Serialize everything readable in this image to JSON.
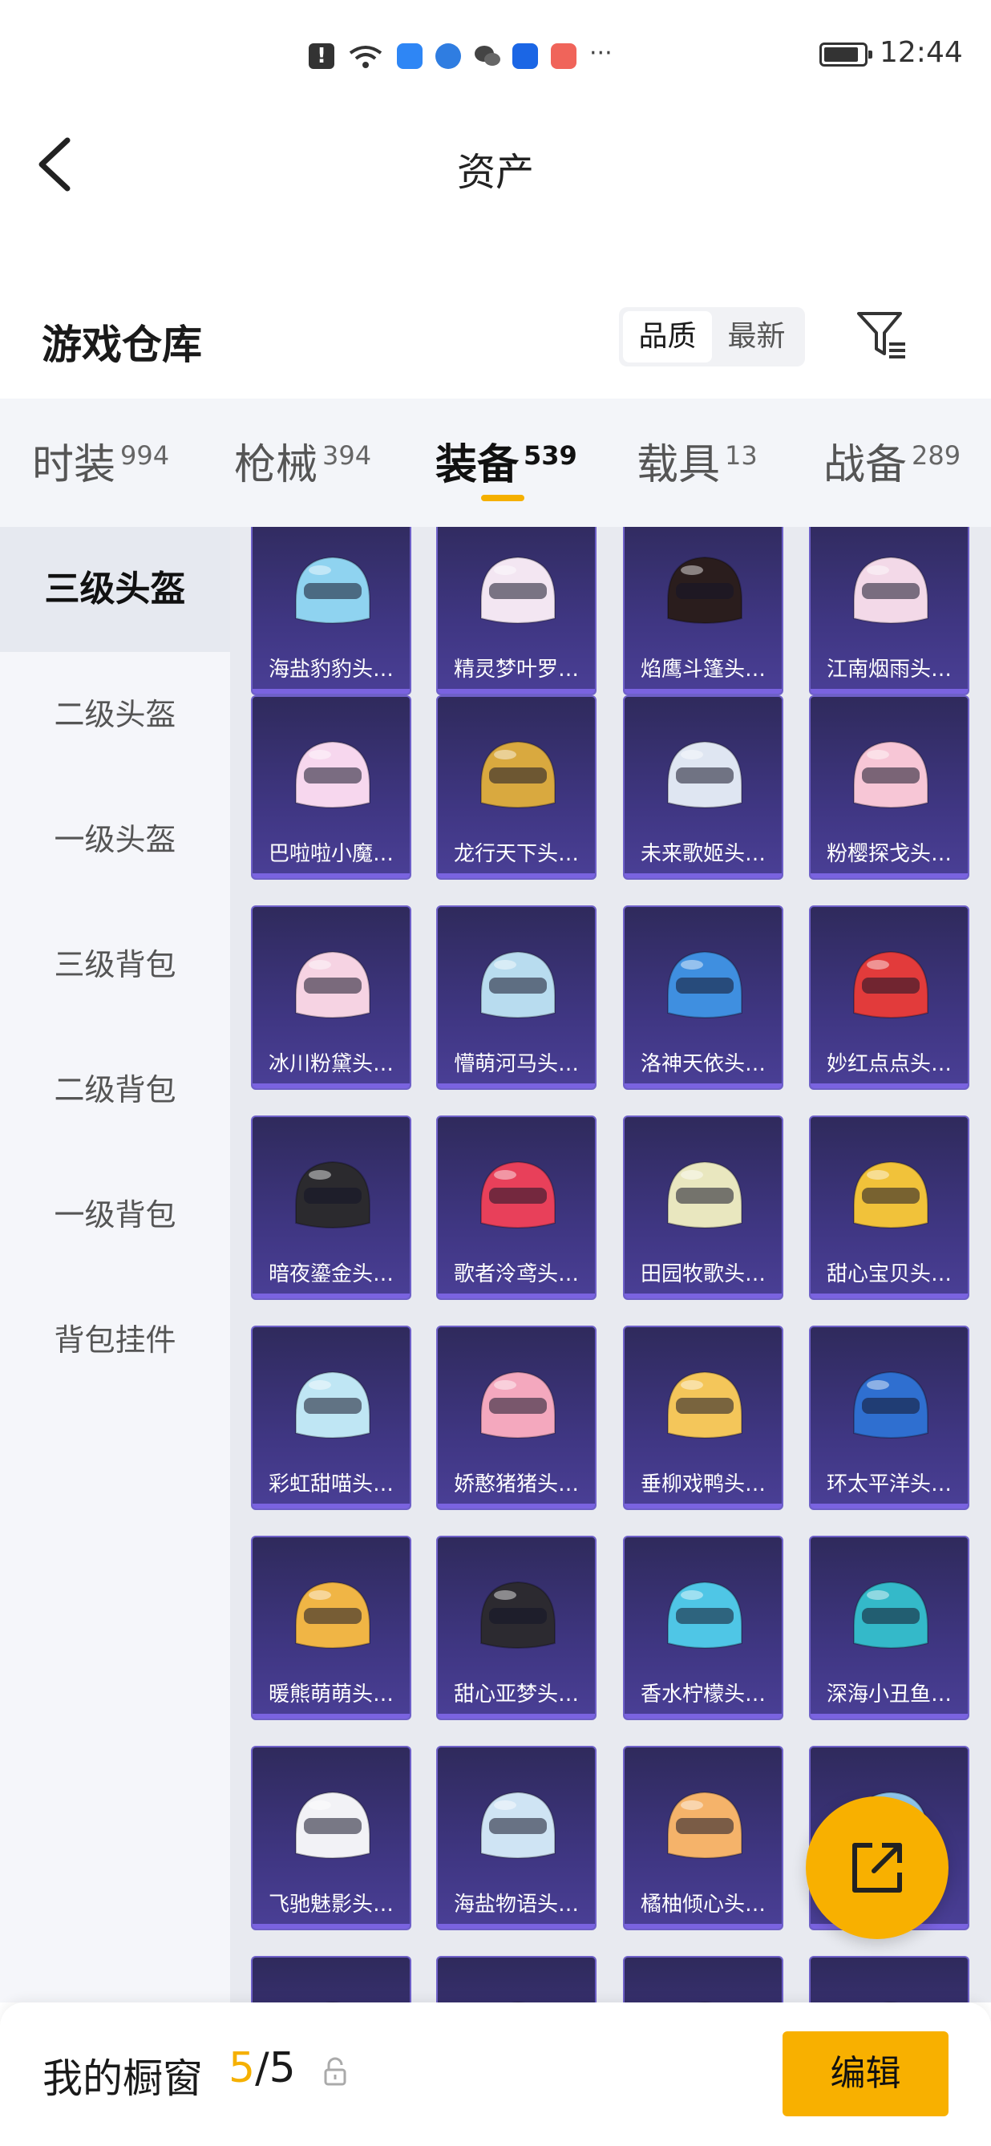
{
  "status_bar": {
    "time": "12:44",
    "alert_glyph": "!",
    "more_glyph": "···",
    "icons": [
      "alert-icon",
      "wifi-icon",
      "cloud-icon",
      "globe-icon",
      "wechat-icon",
      "bulb-icon",
      "gift-icon",
      "more-icon",
      "battery-icon"
    ]
  },
  "nav": {
    "title": "资产",
    "back_icon": "chevron-left-icon"
  },
  "warehouse": {
    "title": "游戏仓库",
    "sort_options": [
      "品质",
      "最新"
    ],
    "active_sort": "品质",
    "filter_icon": "filter-icon"
  },
  "tabs": [
    {
      "label": "时装",
      "count": "994"
    },
    {
      "label": "枪械",
      "count": "394"
    },
    {
      "label": "装备",
      "count": "539"
    },
    {
      "label": "载具",
      "count": "13"
    },
    {
      "label": "战备",
      "count": "289"
    }
  ],
  "active_tab": "装备",
  "sidebar": {
    "items": [
      "三级头盔",
      "二级头盔",
      "一级头盔",
      "三级背包",
      "二级背包",
      "一级背包",
      "背包挂件"
    ],
    "active": "三级头盔"
  },
  "items": [
    {
      "label": "海盐豹豹头…",
      "color": "#8fd3f0"
    },
    {
      "label": "精灵梦叶罗…",
      "color": "#f3e6f2"
    },
    {
      "label": "焰鹰斗篷头…",
      "color": "#2a1d1d"
    },
    {
      "label": "江南烟雨头…",
      "color": "#f3d9e8"
    },
    {
      "label": "巴啦啦小魔…",
      "color": "#f7d7ee"
    },
    {
      "label": "龙行天下头…",
      "color": "#d9a93f"
    },
    {
      "label": "未来歌姬头…",
      "color": "#dfe6f2"
    },
    {
      "label": "粉樱探戈头…",
      "color": "#f7c6d6"
    },
    {
      "label": "冰川粉黛头…",
      "color": "#f6d3e3"
    },
    {
      "label": "懵萌河马头…",
      "color": "#b8dcef"
    },
    {
      "label": "洛神天依头…",
      "color": "#3f8fe0"
    },
    {
      "label": "妙红点点头…",
      "color": "#e23b3b"
    },
    {
      "label": "暗夜鎏金头…",
      "color": "#2b2a2e"
    },
    {
      "label": "歌者泠鸢头…",
      "color": "#e8405a"
    },
    {
      "label": "田园牧歌头…",
      "color": "#e9e7bf"
    },
    {
      "label": "甜心宝贝头…",
      "color": "#f1c23a"
    },
    {
      "label": "彩虹甜喵头…",
      "color": "#bfe6f4"
    },
    {
      "label": "娇憨猪猪头…",
      "color": "#f4a8be"
    },
    {
      "label": "垂柳戏鸭头…",
      "color": "#f4c65a"
    },
    {
      "label": "环太平洋头…",
      "color": "#2f6fd0"
    },
    {
      "label": "暖熊萌萌头…",
      "color": "#f0b545"
    },
    {
      "label": "甜心亚梦头…",
      "color": "#2c2a30"
    },
    {
      "label": "香水柠檬头…",
      "color": "#4fc6e6"
    },
    {
      "label": "深海小丑鱼…",
      "color": "#34b9c9"
    },
    {
      "label": "飞驰魅影头…",
      "color": "#f2f2f6"
    },
    {
      "label": "海盐物语头…",
      "color": "#cfe4f4"
    },
    {
      "label": "橘柚倾心头…",
      "color": "#f5b36a"
    },
    {
      "label": "…",
      "color": "#8fc7ee"
    }
  ],
  "partial_row_colors": [
    "#e0842a",
    "#ee7fbd",
    "#f29b9b",
    "#f7c6d6"
  ],
  "fab": {
    "icon": "share-icon"
  },
  "bottom_bar": {
    "title": "我的橱窗",
    "current": "5",
    "separator": "/",
    "max": "5",
    "lock_icon": "lock-icon",
    "edit_label": "编辑"
  },
  "colors": {
    "accent": "#f8b000",
    "card_bg": "#3f3682",
    "card_border": "#6e60c8"
  }
}
